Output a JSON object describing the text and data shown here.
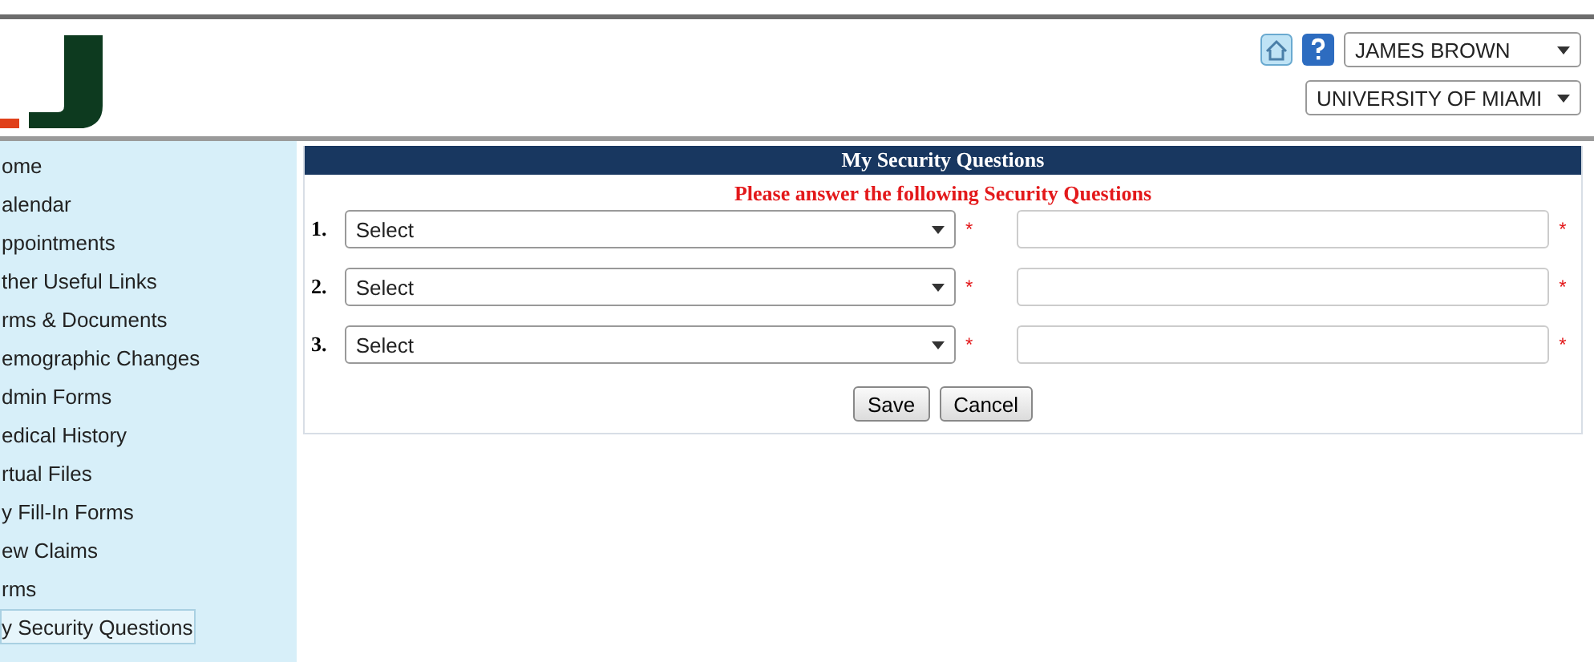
{
  "header": {
    "user_select": "JAMES BROWN",
    "org_select": "UNIVERSITY OF MIAMI"
  },
  "sidebar": {
    "items": [
      {
        "label": "ome",
        "selected": false
      },
      {
        "label": "alendar",
        "selected": false
      },
      {
        "label": "ppointments",
        "selected": false
      },
      {
        "label": "ther Useful Links",
        "selected": false
      },
      {
        "label": "rms & Documents",
        "selected": false
      },
      {
        "label": "emographic Changes",
        "selected": false
      },
      {
        "label": "dmin Forms",
        "selected": false
      },
      {
        "label": "edical History",
        "selected": false
      },
      {
        "label": "rtual Files",
        "selected": false
      },
      {
        "label": "y Fill-In Forms",
        "selected": false
      },
      {
        "label": "ew Claims",
        "selected": false
      },
      {
        "label": "rms",
        "selected": false
      },
      {
        "label": "y Security Questions",
        "selected": true
      }
    ]
  },
  "panel": {
    "title": "My Security Questions",
    "instruction": "Please answer the following Security Questions",
    "questions": [
      {
        "number": "1.",
        "select": "Select",
        "required_mark": "*",
        "answer_mark": "*"
      },
      {
        "number": "2.",
        "select": "Select",
        "required_mark": "*",
        "answer_mark": "*"
      },
      {
        "number": "3.",
        "select": "Select",
        "required_mark": "*",
        "answer_mark": "*"
      }
    ],
    "buttons": [
      "Save",
      "Cancel"
    ]
  }
}
